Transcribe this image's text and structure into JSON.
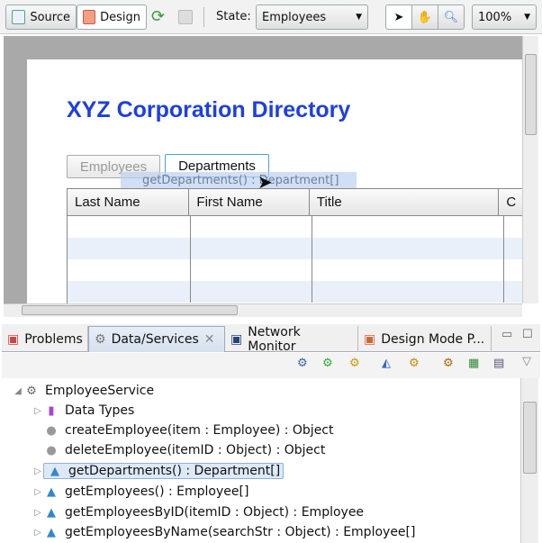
{
  "toolbar": {
    "source": "Source",
    "design": "Design",
    "state_label": "State:",
    "state_value": "Employees",
    "zoom": "100%"
  },
  "design": {
    "title": "XYZ Corporation Directory",
    "tabs": [
      "Employees",
      "Departments"
    ],
    "drag_tooltip": "getDepartments() : Department[]",
    "columns": [
      "Last Name",
      "First Name",
      "Title",
      "C"
    ]
  },
  "panel": {
    "tabs": [
      "Problems",
      "Data/Services",
      "Network Monitor",
      "Design Mode P..."
    ]
  },
  "tree": {
    "root": "EmployeeService",
    "items": [
      "Data Types",
      "createEmployee(item : Employee) : Object",
      "deleteEmployee(itemID : Object) : Object",
      "getDepartments() : Department[]",
      "getEmployees() : Employee[]",
      "getEmployeesByID(itemID : Object) : Employee",
      "getEmployeesByName(searchStr : Object) : Employee[]"
    ]
  }
}
